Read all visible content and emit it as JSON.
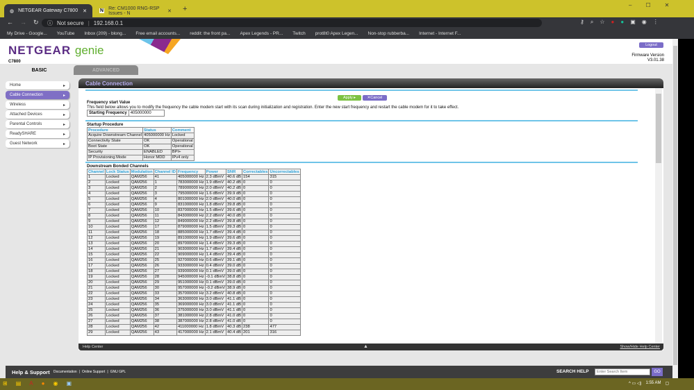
{
  "browser": {
    "tabs": [
      "NETGEAR Gateway C7800",
      "Re: CM1000 RNG-RSP Issues - N"
    ],
    "security": "Not secure",
    "url": "192.168.0.1",
    "bookmarks": [
      "My Drive - Google...",
      "YouTube",
      "Inbox (209) - blong...",
      "Free email accounts...",
      "reddit: the front pa...",
      "Apex Legends - PR...",
      "Twitch",
      "prot8t0 Apex Legen...",
      "Non-stop rubberba...",
      "Internet - Internet F..."
    ]
  },
  "header": {
    "brand": "NETGEAR",
    "product": "genie",
    "model": "C7800",
    "logout": "Logout",
    "firmware_label": "Firmware Version",
    "firmware": "V3.01.38",
    "tabs": [
      "BASIC",
      "ADVANCED"
    ]
  },
  "nav": [
    "Home",
    "Cable Connection",
    "Wireless",
    "Attached Devices",
    "Parental Controls",
    "ReadySHARE",
    "Guest Network"
  ],
  "panel": {
    "title": "Cable Connection",
    "apply": "Apply ▸",
    "cancel": "✕Cancel",
    "freq_title": "Frequency start Value",
    "freq_desc": "This field below allows you to modify the frequency the cable modem start with its scan during initialization and registration. Enter the new start frequency and restart the cable modem for it to take effect.",
    "freq_label": "Starting Frequency",
    "freq_value": "405000000",
    "startup_title": "Startup Procedure",
    "startup_headers": [
      "Procedure",
      "Status",
      "Comment"
    ],
    "startup_rows": [
      [
        "Acquire Downstream Channel",
        "405000000 Hz",
        "Locked"
      ],
      [
        "Connectivity State",
        "OK",
        "Operational"
      ],
      [
        "Boot State",
        "OK",
        "Operational"
      ],
      [
        "Security",
        "ENABLED",
        "BPI+"
      ],
      [
        "IP Provisioning Mode",
        "Honor MDD",
        "IPv4 only"
      ]
    ],
    "ds_title": "Downstream Bonded Channels",
    "ds_headers": [
      "Channel",
      "Lock Status",
      "Modulation",
      "Channel ID",
      "Frequency",
      "Power",
      "SNR",
      "Correctables",
      "Uncorrectables"
    ],
    "ds_rows": [
      [
        "1",
        "Locked",
        "QAM256",
        "41",
        "405000000 Hz",
        "2.3 dBmV",
        "40.6 dB",
        "154",
        "315"
      ],
      [
        "2",
        "Locked",
        "QAM256",
        "1",
        "783000000 Hz",
        "1.9 dBmV",
        "40.2 dB",
        "0",
        "0"
      ],
      [
        "3",
        "Locked",
        "QAM256",
        "2",
        "789000000 Hz",
        "2.0 dBmV",
        "40.2 dB",
        "0",
        "0"
      ],
      [
        "4",
        "Locked",
        "QAM256",
        "3",
        "795000000 Hz",
        "1.6 dBmV",
        "39.9 dB",
        "0",
        "0"
      ],
      [
        "5",
        "Locked",
        "QAM256",
        "4",
        "801000000 Hz",
        "2.0 dBmV",
        "40.0 dB",
        "0",
        "0"
      ],
      [
        "6",
        "Locked",
        "QAM256",
        "9",
        "831000000 Hz",
        "1.8 dBmV",
        "39.8 dB",
        "0",
        "0"
      ],
      [
        "7",
        "Locked",
        "QAM256",
        "10",
        "837000000 Hz",
        "1.5 dBmV",
        "39.6 dB",
        "0",
        "0"
      ],
      [
        "8",
        "Locked",
        "QAM256",
        "11",
        "843000000 Hz",
        "2.2 dBmV",
        "40.0 dB",
        "0",
        "0"
      ],
      [
        "9",
        "Locked",
        "QAM256",
        "12",
        "849000000 Hz",
        "2.2 dBmV",
        "39.8 dB",
        "0",
        "0"
      ],
      [
        "10",
        "Locked",
        "QAM256",
        "17",
        "879000000 Hz",
        "1.5 dBmV",
        "39.3 dB",
        "0",
        "0"
      ],
      [
        "11",
        "Locked",
        "QAM256",
        "18",
        "885000000 Hz",
        "1.7 dBmV",
        "39.4 dB",
        "0",
        "0"
      ],
      [
        "12",
        "Locked",
        "QAM256",
        "19",
        "891000000 Hz",
        "1.9 dBmV",
        "39.6 dB",
        "0",
        "0"
      ],
      [
        "13",
        "Locked",
        "QAM256",
        "20",
        "897000000 Hz",
        "1.4 dBmV",
        "39.3 dB",
        "0",
        "0"
      ],
      [
        "14",
        "Locked",
        "QAM256",
        "21",
        "903000000 Hz",
        "1.7 dBmV",
        "39.4 dB",
        "0",
        "0"
      ],
      [
        "15",
        "Locked",
        "QAM256",
        "22",
        "909000000 Hz",
        "1.4 dBmV",
        "39.4 dB",
        "0",
        "0"
      ],
      [
        "16",
        "Locked",
        "QAM256",
        "25",
        "927000000 Hz",
        "0.6 dBmV",
        "39.1 dB",
        "0",
        "0"
      ],
      [
        "17",
        "Locked",
        "QAM256",
        "26",
        "933000000 Hz",
        "0.4 dBmV",
        "39.0 dB",
        "0",
        "0"
      ],
      [
        "18",
        "Locked",
        "QAM256",
        "27",
        "939000000 Hz",
        "0.1 dBmV",
        "39.0 dB",
        "0",
        "0"
      ],
      [
        "19",
        "Locked",
        "QAM256",
        "28",
        "945000000 Hz",
        "-0.1 dBmV",
        "38.8 dB",
        "0",
        "0"
      ],
      [
        "20",
        "Locked",
        "QAM256",
        "29",
        "951000000 Hz",
        "0.1 dBmV",
        "39.0 dB",
        "0",
        "0"
      ],
      [
        "21",
        "Locked",
        "QAM256",
        "30",
        "957000000 Hz",
        "-0.2 dBmV",
        "38.9 dB",
        "0",
        "0"
      ],
      [
        "22",
        "Locked",
        "QAM256",
        "33",
        "357000000 Hz",
        "3.2 dBmV",
        "40.8 dB",
        "0",
        "0"
      ],
      [
        "23",
        "Locked",
        "QAM256",
        "34",
        "363000000 Hz",
        "3.0 dBmV",
        "41.1 dB",
        "0",
        "0"
      ],
      [
        "24",
        "Locked",
        "QAM256",
        "35",
        "369000000 Hz",
        "3.0 dBmV",
        "41.1 dB",
        "0",
        "0"
      ],
      [
        "25",
        "Locked",
        "QAM256",
        "36",
        "375000000 Hz",
        "3.0 dBmV",
        "41.1 dB",
        "0",
        "0"
      ],
      [
        "26",
        "Locked",
        "QAM256",
        "37",
        "381000000 Hz",
        "2.8 dBmV",
        "41.0 dB",
        "0",
        "0"
      ],
      [
        "27",
        "Locked",
        "QAM256",
        "38",
        "387000000 Hz",
        "2.8 dBmV",
        "41.0 dB",
        "0",
        "0"
      ],
      [
        "28",
        "Locked",
        "QAM256",
        "42",
        "411000000 Hz",
        "1.8 dBmV",
        "40.3 dB",
        "238",
        "477"
      ],
      [
        "29",
        "Locked",
        "QAM256",
        "43",
        "417000000 Hz",
        "2.1 dBmV",
        "40.4 dB",
        "201",
        "316"
      ]
    ],
    "help_center": "Help Center",
    "show_hide": "Show/Hide Help Center"
  },
  "footer": {
    "title": "Help & Support",
    "links": [
      "Documentation",
      "Online Support",
      "GNU GPL"
    ],
    "search_label": "SEARCH HELP",
    "search_placeholder": "Enter Search Item",
    "go": "GO"
  },
  "taskbar": {
    "time": "1:55 AM"
  }
}
